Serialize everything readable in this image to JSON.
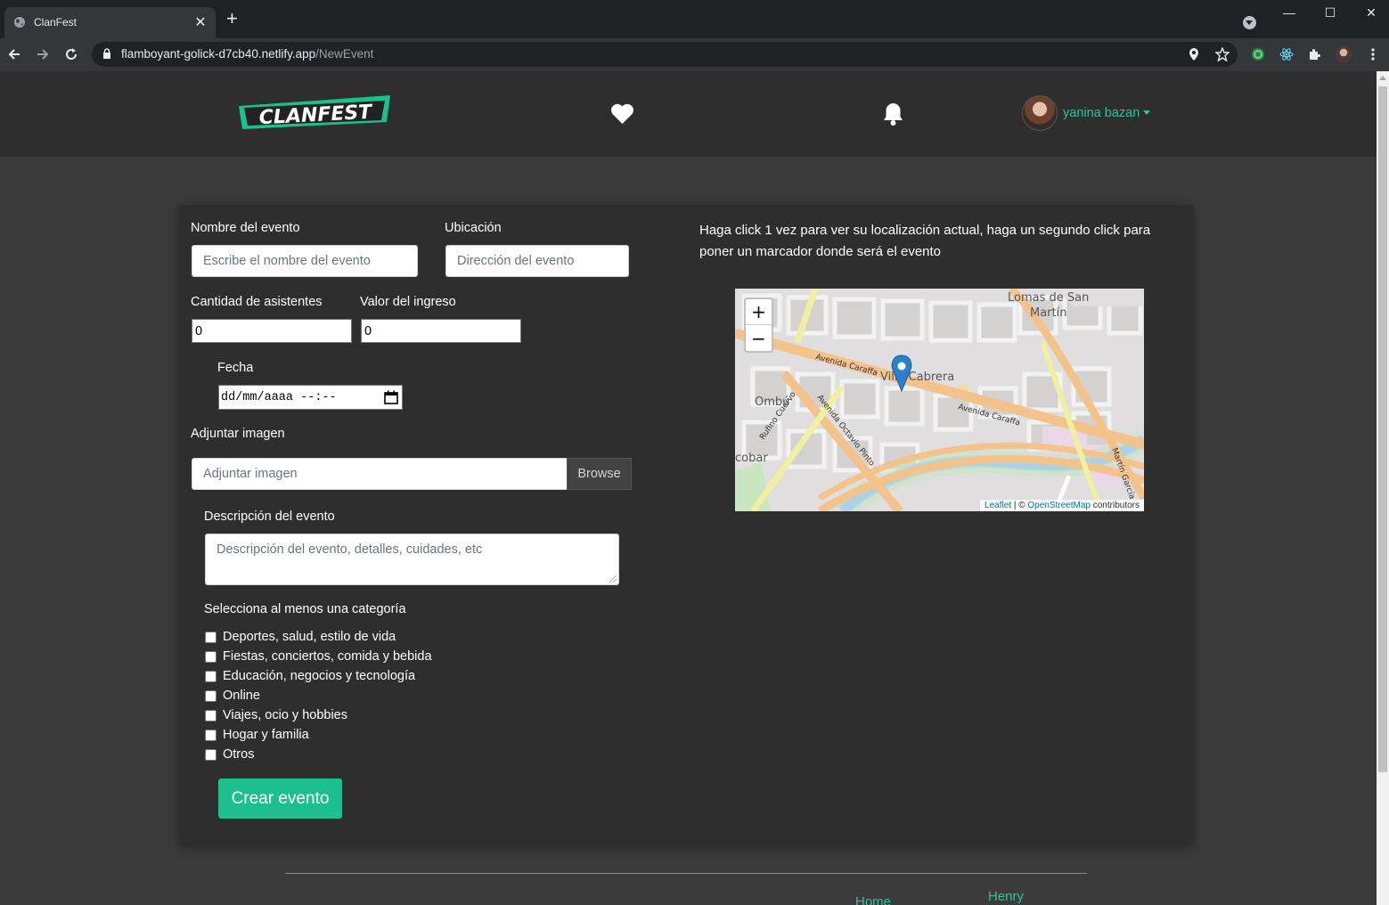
{
  "browser": {
    "tab_title": "ClanFest",
    "url_host": "flamboyant-golick-d7cb40.netlify.app",
    "url_path": "/NewEvent"
  },
  "header": {
    "logo_text": "CLANFEST",
    "username": "yanina bazan"
  },
  "form": {
    "name_label": "Nombre del evento",
    "name_placeholder": "Escribe el nombre del evento",
    "location_label": "Ubicación",
    "location_placeholder": "Dirección del evento",
    "attendees_label": "Cantidad de asistentes",
    "attendees_value": "0",
    "price_label": "Valor del ingreso",
    "price_value": "0",
    "date_label": "Fecha",
    "date_value": "dd/mm/aaaa --:--",
    "image_label": "Adjuntar imagen",
    "image_placeholder": "Adjuntar imagen",
    "browse_label": "Browse",
    "description_label": "Descripción del evento",
    "description_placeholder": "Descripción del evento, detalles, cuidades, etc",
    "categories_label": "Selecciona al menos una categoría",
    "categories": [
      "Deportes, salud, estilo de vida",
      "Fiestas, conciertos, comida y bebida",
      "Educación, negocios y tecnología",
      "Online",
      "Viajes, ocio y hobbies",
      "Hogar y familia",
      "Otros"
    ],
    "submit_label": "Crear evento"
  },
  "map": {
    "instructions": "Haga click 1 vez para ver su localización actual, haga un segundo click para poner un marcador donde será el evento",
    "zoom_in": "+",
    "zoom_out": "−",
    "attribution_leaflet": "Leaflet",
    "attribution_sep": " | © ",
    "attribution_osm": "OpenStreetMap",
    "attribution_tail": " contributors",
    "labels": {
      "neighborhood_1": "Lomas de San",
      "neighborhood_2": "Martín",
      "village": "Villa Cabrera",
      "ombu": "Ombú",
      "cobar": "cobar",
      "av_caraffa_1": "Avenida Caraffa",
      "av_caraffa_2": "Avenida Caraffa",
      "av_octavio": "Avenida Octavio Pinto",
      "rufino": "Rufino Cuervo",
      "martin_garcia": "Martín García"
    }
  },
  "footer": {
    "link_home": "Home",
    "link_henry": "Henry"
  },
  "colors": {
    "accent": "#1cbf8d",
    "card_bg": "#2f2e2f",
    "page_bg": "#3c3b3c"
  }
}
